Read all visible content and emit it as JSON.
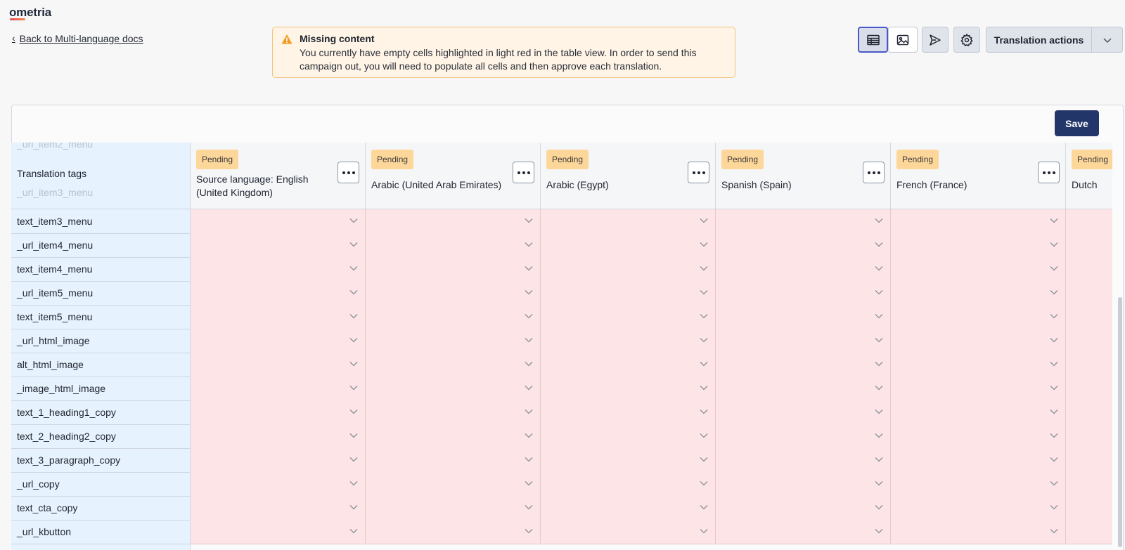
{
  "app": {
    "logo": "ometria"
  },
  "nav": {
    "back_label": "Back to Multi-language docs"
  },
  "alert": {
    "title": "Missing content",
    "body": "You currently have empty cells highlighted in light red in the table view. In order to send this campaign out, you will need to populate all cells and then approve each translation."
  },
  "toolbar": {
    "buttons": [
      {
        "icon": "table-view-icon",
        "active": true
      },
      {
        "icon": "image-preview-icon",
        "active": false
      },
      {
        "icon": "send-icon",
        "active": false
      },
      {
        "icon": "gear-icon",
        "active": false
      }
    ],
    "translation_actions_label": "Translation actions",
    "save_label": "Save"
  },
  "table": {
    "tags_header": "Translation tags",
    "faded_above": "_url_item2_menu",
    "faded_below": "_url_item3_menu",
    "columns": [
      {
        "status": "Pending",
        "language": "Source language: English (United Kingdom)"
      },
      {
        "status": "Pending",
        "language": "Arabic (United Arab Emirates)"
      },
      {
        "status": "Pending",
        "language": "Arabic (Egypt)"
      },
      {
        "status": "Pending",
        "language": "Spanish (Spain)"
      },
      {
        "status": "Pending",
        "language": "French (France)"
      },
      {
        "status": "Pending",
        "language": "Dutch"
      }
    ],
    "rows": [
      "text_item3_menu",
      "_url_item4_menu",
      "text_item4_menu",
      "_url_item5_menu",
      "text_item5_menu",
      "_url_html_image",
      "alt_html_image",
      "_image_html_image",
      "text_1_heading1_copy",
      "text_2_heading2_copy",
      "text_3_paragraph_copy",
      "_url_copy",
      "text_cta_copy",
      "_url_kbutton"
    ]
  },
  "colors": {
    "empty_cell": "#fce4e7",
    "tag_column": "#e6f2fd",
    "pending_badge": "#fdd79a",
    "save_button": "#233669"
  }
}
